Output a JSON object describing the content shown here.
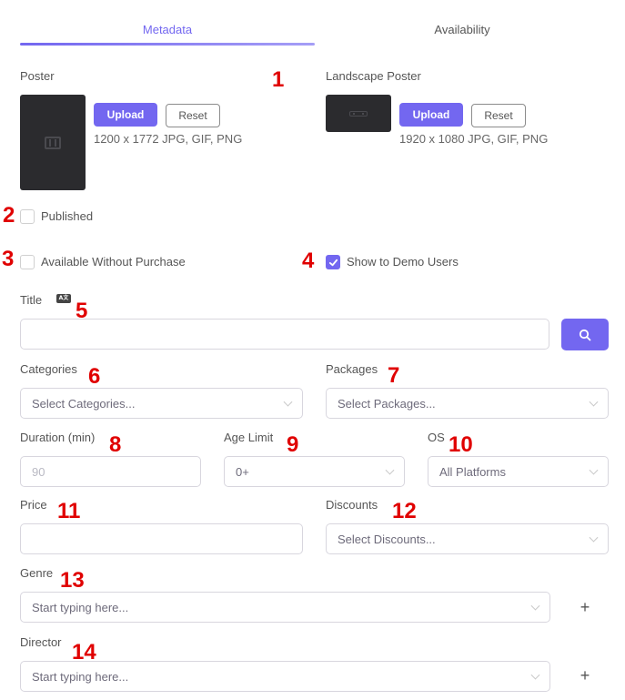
{
  "tabs": [
    {
      "label": "Metadata",
      "active": true
    },
    {
      "label": "Availability",
      "active": false
    }
  ],
  "poster": {
    "label": "Poster",
    "upload": "Upload",
    "reset": "Reset",
    "hint": "1200 x 1772 JPG, GIF, PNG"
  },
  "landscape": {
    "label": "Landscape Poster",
    "upload": "Upload",
    "reset": "Reset",
    "hint": "1920 x 1080 JPG, GIF, PNG"
  },
  "checkboxes": {
    "published": {
      "label": "Published",
      "checked": false
    },
    "available_without_purchase": {
      "label": "Available Without Purchase",
      "checked": false
    },
    "show_to_demo_users": {
      "label": "Show to Demo Users",
      "checked": true
    }
  },
  "title_field": {
    "label": "Title",
    "value": "",
    "icon": "language-icon"
  },
  "categories": {
    "label": "Categories",
    "placeholder": "Select Categories..."
  },
  "packages": {
    "label": "Packages",
    "placeholder": "Select Packages..."
  },
  "duration": {
    "label": "Duration (min)",
    "placeholder": "90"
  },
  "age_limit": {
    "label": "Age Limit",
    "value": "0+"
  },
  "os": {
    "label": "OS",
    "value": "All Platforms"
  },
  "price": {
    "label": "Price",
    "value": ""
  },
  "discounts": {
    "label": "Discounts",
    "placeholder": "Select Discounts..."
  },
  "genre": {
    "label": "Genre",
    "placeholder": "Start typing here...",
    "add": "+"
  },
  "director": {
    "label": "Director",
    "placeholder": "Start typing here...",
    "add": "+"
  },
  "annotations": [
    "1",
    "2",
    "3",
    "4",
    "5",
    "6",
    "7",
    "8",
    "9",
    "10",
    "11",
    "12",
    "13",
    "14"
  ],
  "colors": {
    "accent": "#7367f0",
    "annotation": "#e00000",
    "thumb": "#2b2b2e"
  }
}
